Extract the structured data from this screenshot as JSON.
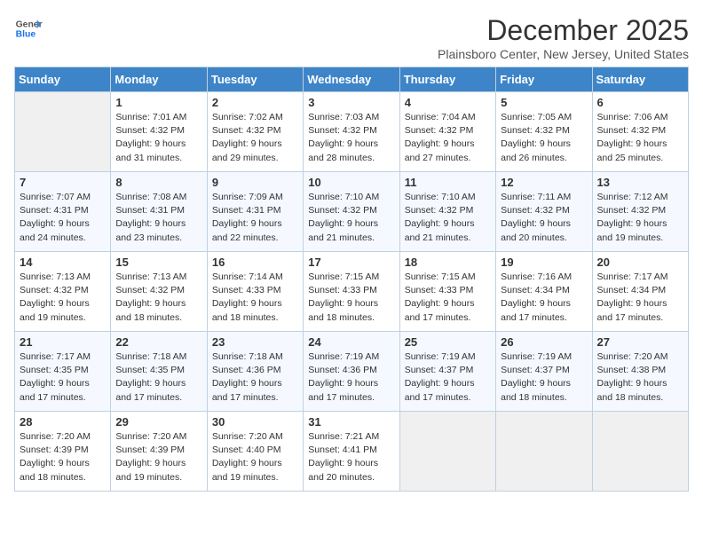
{
  "logo": {
    "line1": "General",
    "line2": "Blue"
  },
  "title": "December 2025",
  "location": "Plainsboro Center, New Jersey, United States",
  "days_of_week": [
    "Sunday",
    "Monday",
    "Tuesday",
    "Wednesday",
    "Thursday",
    "Friday",
    "Saturday"
  ],
  "weeks": [
    [
      {
        "day": "",
        "info": ""
      },
      {
        "day": "1",
        "info": "Sunrise: 7:01 AM\nSunset: 4:32 PM\nDaylight: 9 hours\nand 31 minutes."
      },
      {
        "day": "2",
        "info": "Sunrise: 7:02 AM\nSunset: 4:32 PM\nDaylight: 9 hours\nand 29 minutes."
      },
      {
        "day": "3",
        "info": "Sunrise: 7:03 AM\nSunset: 4:32 PM\nDaylight: 9 hours\nand 28 minutes."
      },
      {
        "day": "4",
        "info": "Sunrise: 7:04 AM\nSunset: 4:32 PM\nDaylight: 9 hours\nand 27 minutes."
      },
      {
        "day": "5",
        "info": "Sunrise: 7:05 AM\nSunset: 4:32 PM\nDaylight: 9 hours\nand 26 minutes."
      },
      {
        "day": "6",
        "info": "Sunrise: 7:06 AM\nSunset: 4:32 PM\nDaylight: 9 hours\nand 25 minutes."
      }
    ],
    [
      {
        "day": "7",
        "info": "Sunrise: 7:07 AM\nSunset: 4:31 PM\nDaylight: 9 hours\nand 24 minutes."
      },
      {
        "day": "8",
        "info": "Sunrise: 7:08 AM\nSunset: 4:31 PM\nDaylight: 9 hours\nand 23 minutes."
      },
      {
        "day": "9",
        "info": "Sunrise: 7:09 AM\nSunset: 4:31 PM\nDaylight: 9 hours\nand 22 minutes."
      },
      {
        "day": "10",
        "info": "Sunrise: 7:10 AM\nSunset: 4:32 PM\nDaylight: 9 hours\nand 21 minutes."
      },
      {
        "day": "11",
        "info": "Sunrise: 7:10 AM\nSunset: 4:32 PM\nDaylight: 9 hours\nand 21 minutes."
      },
      {
        "day": "12",
        "info": "Sunrise: 7:11 AM\nSunset: 4:32 PM\nDaylight: 9 hours\nand 20 minutes."
      },
      {
        "day": "13",
        "info": "Sunrise: 7:12 AM\nSunset: 4:32 PM\nDaylight: 9 hours\nand 19 minutes."
      }
    ],
    [
      {
        "day": "14",
        "info": "Sunrise: 7:13 AM\nSunset: 4:32 PM\nDaylight: 9 hours\nand 19 minutes."
      },
      {
        "day": "15",
        "info": "Sunrise: 7:13 AM\nSunset: 4:32 PM\nDaylight: 9 hours\nand 18 minutes."
      },
      {
        "day": "16",
        "info": "Sunrise: 7:14 AM\nSunset: 4:33 PM\nDaylight: 9 hours\nand 18 minutes."
      },
      {
        "day": "17",
        "info": "Sunrise: 7:15 AM\nSunset: 4:33 PM\nDaylight: 9 hours\nand 18 minutes."
      },
      {
        "day": "18",
        "info": "Sunrise: 7:15 AM\nSunset: 4:33 PM\nDaylight: 9 hours\nand 17 minutes."
      },
      {
        "day": "19",
        "info": "Sunrise: 7:16 AM\nSunset: 4:34 PM\nDaylight: 9 hours\nand 17 minutes."
      },
      {
        "day": "20",
        "info": "Sunrise: 7:17 AM\nSunset: 4:34 PM\nDaylight: 9 hours\nand 17 minutes."
      }
    ],
    [
      {
        "day": "21",
        "info": "Sunrise: 7:17 AM\nSunset: 4:35 PM\nDaylight: 9 hours\nand 17 minutes."
      },
      {
        "day": "22",
        "info": "Sunrise: 7:18 AM\nSunset: 4:35 PM\nDaylight: 9 hours\nand 17 minutes."
      },
      {
        "day": "23",
        "info": "Sunrise: 7:18 AM\nSunset: 4:36 PM\nDaylight: 9 hours\nand 17 minutes."
      },
      {
        "day": "24",
        "info": "Sunrise: 7:19 AM\nSunset: 4:36 PM\nDaylight: 9 hours\nand 17 minutes."
      },
      {
        "day": "25",
        "info": "Sunrise: 7:19 AM\nSunset: 4:37 PM\nDaylight: 9 hours\nand 17 minutes."
      },
      {
        "day": "26",
        "info": "Sunrise: 7:19 AM\nSunset: 4:37 PM\nDaylight: 9 hours\nand 18 minutes."
      },
      {
        "day": "27",
        "info": "Sunrise: 7:20 AM\nSunset: 4:38 PM\nDaylight: 9 hours\nand 18 minutes."
      }
    ],
    [
      {
        "day": "28",
        "info": "Sunrise: 7:20 AM\nSunset: 4:39 PM\nDaylight: 9 hours\nand 18 minutes."
      },
      {
        "day": "29",
        "info": "Sunrise: 7:20 AM\nSunset: 4:39 PM\nDaylight: 9 hours\nand 19 minutes."
      },
      {
        "day": "30",
        "info": "Sunrise: 7:20 AM\nSunset: 4:40 PM\nDaylight: 9 hours\nand 19 minutes."
      },
      {
        "day": "31",
        "info": "Sunrise: 7:21 AM\nSunset: 4:41 PM\nDaylight: 9 hours\nand 20 minutes."
      },
      {
        "day": "",
        "info": ""
      },
      {
        "day": "",
        "info": ""
      },
      {
        "day": "",
        "info": ""
      }
    ]
  ]
}
